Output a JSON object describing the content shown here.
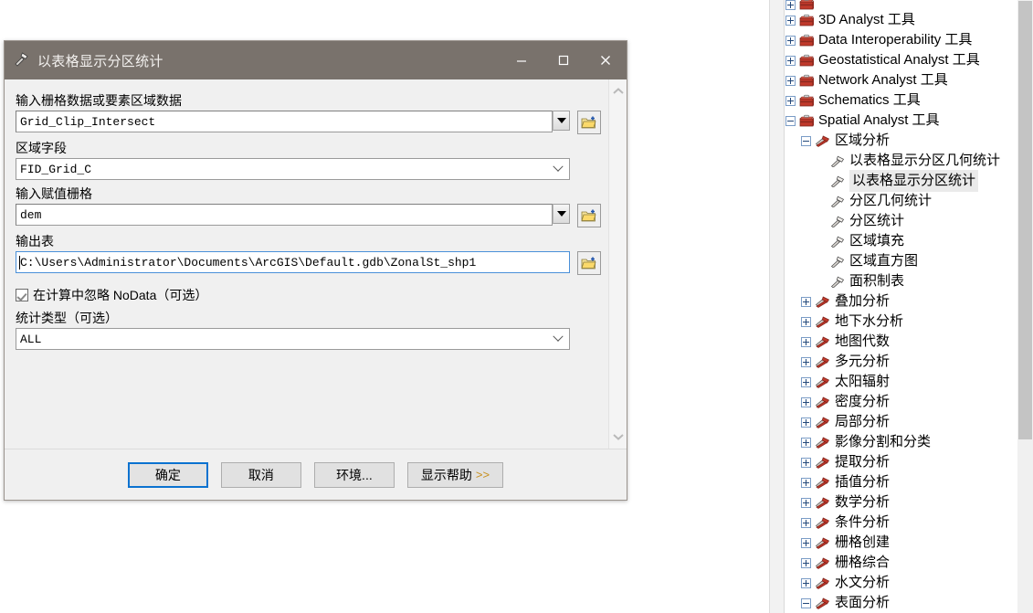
{
  "dialog": {
    "title": "以表格显示分区统计",
    "title_icon": "hammer-tool-icon",
    "window_controls": {
      "minimize": "minimize-icon",
      "maximize": "maximize-icon",
      "close": "close-icon"
    },
    "fields": [
      {
        "label": "输入栅格数据或要素区域数据",
        "value": "Grid_Clip_Intersect",
        "kind": "combo",
        "browse": true
      },
      {
        "label": "区域字段",
        "value": "FID_Grid_C",
        "kind": "select",
        "browse": false
      },
      {
        "label": "输入赋值栅格",
        "value": "dem",
        "kind": "combo",
        "browse": true
      },
      {
        "label": "输出表",
        "value": "C:\\Users\\Administrator\\Documents\\ArcGIS\\Default.gdb\\ZonalSt_shp1",
        "kind": "text",
        "browse": true
      }
    ],
    "checkbox": {
      "label": "在计算中忽略 NoData（可选）",
      "checked": true
    },
    "stats_label": "统计类型（可选）",
    "stats_value": "ALL",
    "buttons": {
      "ok": "确定",
      "cancel": "取消",
      "environments": "环境...",
      "help": "显示帮助",
      "help_chevrons": ">>"
    }
  },
  "tree": {
    "items": [
      {
        "label": "",
        "depth": 1,
        "icon": "toolbox-icon",
        "expander": "plus",
        "partial": true
      },
      {
        "label": "3D Analyst 工具",
        "depth": 1,
        "icon": "toolbox-icon",
        "expander": "plus"
      },
      {
        "label": "Data Interoperability 工具",
        "depth": 1,
        "icon": "toolbox-icon",
        "expander": "plus"
      },
      {
        "label": "Geostatistical Analyst 工具",
        "depth": 1,
        "icon": "toolbox-icon",
        "expander": "plus"
      },
      {
        "label": "Network Analyst 工具",
        "depth": 1,
        "icon": "toolbox-icon",
        "expander": "plus"
      },
      {
        "label": "Schematics 工具",
        "depth": 1,
        "icon": "toolbox-icon",
        "expander": "plus"
      },
      {
        "label": "Spatial Analyst 工具",
        "depth": 1,
        "icon": "toolbox-icon",
        "expander": "minus"
      },
      {
        "label": "区域分析",
        "depth": 2,
        "icon": "toolset-icon",
        "expander": "minus"
      },
      {
        "label": "以表格显示分区几何统计",
        "depth": 3,
        "icon": "tool-icon",
        "expander": "none"
      },
      {
        "label": "以表格显示分区统计",
        "depth": 3,
        "icon": "tool-icon",
        "expander": "none",
        "selected": true
      },
      {
        "label": "分区几何统计",
        "depth": 3,
        "icon": "tool-icon",
        "expander": "none"
      },
      {
        "label": "分区统计",
        "depth": 3,
        "icon": "tool-icon",
        "expander": "none"
      },
      {
        "label": "区域填充",
        "depth": 3,
        "icon": "tool-icon",
        "expander": "none"
      },
      {
        "label": "区域直方图",
        "depth": 3,
        "icon": "tool-icon",
        "expander": "none"
      },
      {
        "label": "面积制表",
        "depth": 3,
        "icon": "tool-icon",
        "expander": "none"
      },
      {
        "label": "叠加分析",
        "depth": 2,
        "icon": "toolset-icon",
        "expander": "plus"
      },
      {
        "label": "地下水分析",
        "depth": 2,
        "icon": "toolset-icon",
        "expander": "plus"
      },
      {
        "label": "地图代数",
        "depth": 2,
        "icon": "toolset-icon",
        "expander": "plus"
      },
      {
        "label": "多元分析",
        "depth": 2,
        "icon": "toolset-icon",
        "expander": "plus"
      },
      {
        "label": "太阳辐射",
        "depth": 2,
        "icon": "toolset-icon",
        "expander": "plus"
      },
      {
        "label": "密度分析",
        "depth": 2,
        "icon": "toolset-icon",
        "expander": "plus"
      },
      {
        "label": "局部分析",
        "depth": 2,
        "icon": "toolset-icon",
        "expander": "plus"
      },
      {
        "label": "影像分割和分类",
        "depth": 2,
        "icon": "toolset-icon",
        "expander": "plus"
      },
      {
        "label": "提取分析",
        "depth": 2,
        "icon": "toolset-icon",
        "expander": "plus"
      },
      {
        "label": "插值分析",
        "depth": 2,
        "icon": "toolset-icon",
        "expander": "plus"
      },
      {
        "label": "数学分析",
        "depth": 2,
        "icon": "toolset-icon",
        "expander": "plus"
      },
      {
        "label": "条件分析",
        "depth": 2,
        "icon": "toolset-icon",
        "expander": "plus"
      },
      {
        "label": "栅格创建",
        "depth": 2,
        "icon": "toolset-icon",
        "expander": "plus"
      },
      {
        "label": "栅格综合",
        "depth": 2,
        "icon": "toolset-icon",
        "expander": "plus"
      },
      {
        "label": "水文分析",
        "depth": 2,
        "icon": "toolset-icon",
        "expander": "plus"
      },
      {
        "label": "表面分析",
        "depth": 2,
        "icon": "toolset-icon",
        "expander": "minus"
      }
    ]
  },
  "colors": {
    "titlebar": "#79726c",
    "dialog_bg": "#f0f0f0",
    "accent_button_border": "#0b72d0",
    "selection": "#eaeaea",
    "toolbox_icon": "#c0392b",
    "help_chevron": "#c8901e"
  }
}
